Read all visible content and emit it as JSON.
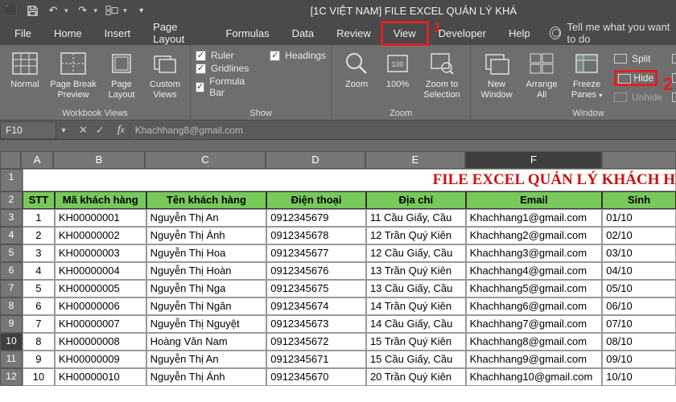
{
  "titlebar": {
    "title": "[1C VIỆT NAM] FILE EXCEL QUẢN LÝ KHÁ"
  },
  "menu": {
    "file": "File",
    "home": "Home",
    "insert": "Insert",
    "pagelayout": "Page Layout",
    "formulas": "Formulas",
    "data": "Data",
    "review": "Review",
    "view": "View",
    "developer": "Developer",
    "help": "Help",
    "tellme": "Tell me what you want to do"
  },
  "annot": {
    "one": "1",
    "two": "2"
  },
  "ribbon": {
    "views": {
      "normal": "Normal",
      "pagebreak": "Page Break Preview",
      "pagelayout": "Page Layout",
      "custom": "Custom Views",
      "group": "Workbook Views"
    },
    "show": {
      "ruler": "Ruler",
      "gridlines": "Gridlines",
      "formulabar": "Formula Bar",
      "headings": "Headings",
      "group": "Show"
    },
    "zoom": {
      "zoom": "Zoom",
      "hundred": "100%",
      "selection": "Zoom to Selection",
      "group": "Zoom"
    },
    "window": {
      "new": "New Window",
      "arrange": "Arrange All",
      "freeze": "Freeze Panes",
      "split": "Split",
      "hide": "Hide",
      "unhide": "Unhide",
      "group": "Window"
    }
  },
  "fx": {
    "namebox": "F10",
    "formula": "Khachhang8@gmail.com"
  },
  "sheet": {
    "cols": [
      "A",
      "B",
      "C",
      "D",
      "E",
      "F"
    ],
    "lastcol_index": 5,
    "title": "FILE EXCEL QUẢN LÝ KHÁCH H",
    "headers": {
      "stt": "STT",
      "ma": "Mã khách hàng",
      "ten": "Tên khách hàng",
      "dt": "Điện thoại",
      "dc": "Địa chỉ",
      "email": "Email",
      "sinh": "Sinh"
    },
    "rows": [
      {
        "r": 3,
        "stt": "1",
        "ma": "KH00000001",
        "ten": "Nguyễn Thị An",
        "dt": "0912345679",
        "dc": "11 Cầu Giấy, Cầu",
        "email": "Khachhang1@gmail.com",
        "sinh": "01/10"
      },
      {
        "r": 4,
        "stt": "2",
        "ma": "KH00000002",
        "ten": "Nguyễn Thị Ánh",
        "dt": "0912345678",
        "dc": "12 Trần Quý Kiên",
        "email": "Khachhang2@gmail.com",
        "sinh": "02/10"
      },
      {
        "r": 5,
        "stt": "3",
        "ma": "KH00000003",
        "ten": "Nguyễn Thị Hoa",
        "dt": "0912345677",
        "dc": "12 Cầu Giấy, Cầu",
        "email": "Khachhang3@gmail.com",
        "sinh": "03/10"
      },
      {
        "r": 6,
        "stt": "4",
        "ma": "KH00000004",
        "ten": "Nguyễn Thị Hoàn",
        "dt": "0912345676",
        "dc": "13 Trần Quý Kiên",
        "email": "Khachhang4@gmail.com",
        "sinh": "04/10"
      },
      {
        "r": 7,
        "stt": "5",
        "ma": "KH00000005",
        "ten": "Nguyễn Thị Nga",
        "dt": "0912345675",
        "dc": "13 Cầu Giấy, Cầu",
        "email": "Khachhang5@gmail.com",
        "sinh": "05/10"
      },
      {
        "r": 8,
        "stt": "6",
        "ma": "KH00000006",
        "ten": "Nguyễn Thị Ngân",
        "dt": "0912345674",
        "dc": "14 Trần Quý Kiên",
        "email": "Khachhang6@gmail.com",
        "sinh": "06/10"
      },
      {
        "r": 9,
        "stt": "7",
        "ma": "KH00000007",
        "ten": "Nguyễn Thị Nguyệt",
        "dt": "0912345673",
        "dc": "14 Cầu Giấy, Cầu",
        "email": "Khachhang7@gmail.com",
        "sinh": "07/10"
      },
      {
        "r": 10,
        "stt": "8",
        "ma": "KH00000008",
        "ten": "Hoàng Văn Nam",
        "dt": "0912345672",
        "dc": "15 Trần Quý Kiên",
        "email": "Khachhang8@gmail.com",
        "sinh": "08/10"
      },
      {
        "r": 11,
        "stt": "9",
        "ma": "KH00000009",
        "ten": "Nguyễn Thị An",
        "dt": "0912345671",
        "dc": "15 Cầu Giấy, Cầu",
        "email": "Khachhang9@gmail.com",
        "sinh": "09/10"
      },
      {
        "r": 12,
        "stt": "10",
        "ma": "KH00000010",
        "ten": "Nguyễn Thị Ánh",
        "dt": "0912345670",
        "dc": "20 Trần Quý Kiên",
        "email": "Khachhang10@gmail.com",
        "sinh": "10/10"
      }
    ],
    "selected_row": 10
  }
}
